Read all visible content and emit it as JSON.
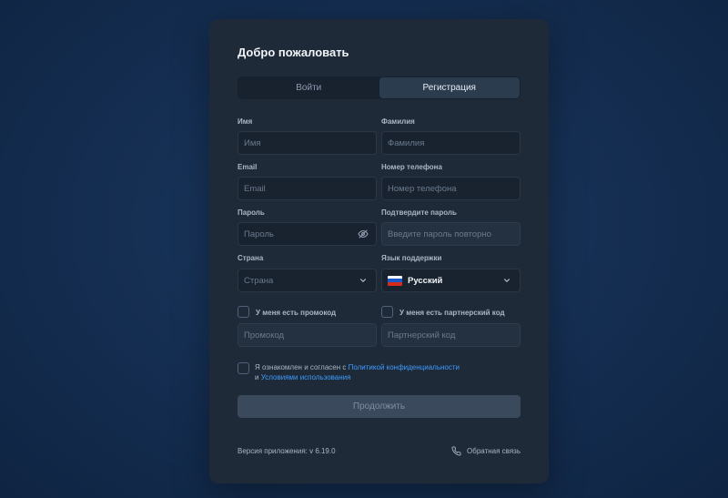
{
  "header": {
    "title": "Добро пожаловать"
  },
  "tabs": [
    {
      "label": "Войти",
      "active": false
    },
    {
      "label": "Регистрация",
      "active": true
    }
  ],
  "form": {
    "first_name": {
      "label": "Имя",
      "placeholder": "Имя",
      "value": ""
    },
    "last_name": {
      "label": "Фамилия",
      "placeholder": "Фамилия",
      "value": ""
    },
    "email": {
      "label": "Email",
      "placeholder": "Email",
      "value": ""
    },
    "phone": {
      "label": "Номер телефона",
      "placeholder": "Номер телефона",
      "value": ""
    },
    "password": {
      "label": "Пароль",
      "placeholder": "Пароль",
      "value": ""
    },
    "confirm_password": {
      "label": "Подтвердите пароль",
      "placeholder": "Введите пароль повторно",
      "value": ""
    },
    "country": {
      "label": "Страна",
      "placeholder": "Страна"
    },
    "support_language": {
      "label": "Язык поддержки",
      "value": "Русский"
    },
    "promo": {
      "checkbox_label": "У меня есть промокод",
      "placeholder": "Промокод",
      "checked": false
    },
    "partner": {
      "checkbox_label": "У меня есть партнерский код",
      "placeholder": "Партнерский код",
      "checked": false
    },
    "agreement": {
      "prefix": "Я ознакомлен и согласен с",
      "privacy_link": "Политикой конфиденциальности",
      "conjunction": "и",
      "terms_link": "Условиями использования",
      "checked": false
    },
    "submit_label": "Продолжить"
  },
  "footer": {
    "version": "Версия приложения: v 6.19.0",
    "feedback": "Обратная связь"
  },
  "colors": {
    "background": "#142d50",
    "card": "#1e2a38",
    "link": "#3f9bff",
    "submit_disabled": "#3a4a5c"
  },
  "icons": {
    "password_toggle": "eye-off-icon",
    "country_dropdown": "chevron-down-icon",
    "language_flag": "russia-flag-icon",
    "feedback": "phone-icon"
  }
}
